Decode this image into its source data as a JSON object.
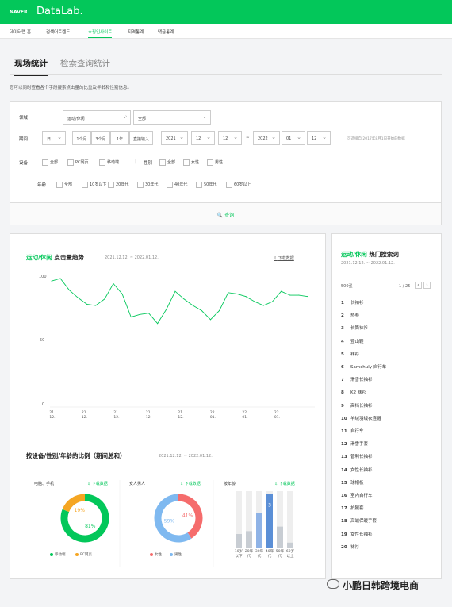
{
  "header": {
    "logo": "NAVER",
    "brand": "DataLab."
  },
  "nav": [
    "데이터랩 홈",
    "검색어트렌드",
    "쇼핑인사이트",
    "지역통계",
    "댓글통계"
  ],
  "tabs": [
    "现场统计",
    "检索查询统计"
  ],
  "desc": "您可以同时查看各个字段搜索点击量的比重及年龄和性别信息。",
  "filter": {
    "field_label": "领域",
    "cat1": "运动/休闲",
    "cat2": "全部",
    "period_label": "期间",
    "period_unit": "日",
    "periods": [
      "1个月",
      "3个月",
      "1年",
      "直接输入"
    ],
    "start": [
      "2021",
      "12",
      "12"
    ],
    "tilde": "~",
    "end": [
      "2022",
      "01",
      "12"
    ],
    "hint": "可选择自 2017年8月1日开始的数据",
    "device_label": "设备",
    "devices": [
      "全部",
      "PC网页",
      "移动端"
    ],
    "gender_label": "性别",
    "genders": [
      "全部",
      "女性",
      "男性"
    ],
    "age_label": "年龄",
    "ages": [
      "全部",
      "10岁以下",
      "20年代",
      "30年代",
      "40年代",
      "50年代",
      "60岁以上"
    ],
    "search": "查询"
  },
  "trend": {
    "cat": "运动/休闲",
    "title": "点击量趋势",
    "date": "2021.12.12. ~ 2022.01.12.",
    "download": "下载数据",
    "ylabels": [
      "100",
      "50",
      "0"
    ],
    "xlabels": [
      [
        "21.",
        "12."
      ],
      [
        "21.",
        "12."
      ],
      [
        "21.",
        "12."
      ],
      [
        "21.",
        "12."
      ],
      [
        "21.",
        "12."
      ],
      [
        "22.",
        "01."
      ],
      [
        "22.",
        "01."
      ],
      [
        "22.",
        "01."
      ]
    ]
  },
  "chart_data": {
    "type": "line",
    "ylim": [
      0,
      100
    ],
    "values": [
      98,
      100,
      91,
      85,
      80,
      79,
      84,
      96,
      88,
      70,
      72,
      73,
      65,
      76,
      90,
      84,
      79,
      75,
      68,
      75,
      89,
      88,
      86,
      82,
      79,
      82,
      90,
      87,
      87,
      86
    ]
  },
  "ratio": {
    "title": "按设备/性别/年龄的比例（期间总和）",
    "date": "2021.12.12. ~ 2022.01.12.",
    "device_title": "电脑、手机",
    "gender_title": "女人男人",
    "age_title": "按年龄",
    "download": "下载数据",
    "device_values": [
      81,
      19
    ],
    "device_pct": [
      "81%",
      "19%"
    ],
    "device_legend": [
      "移动端",
      "PC网页"
    ],
    "gender_values": [
      41,
      59
    ],
    "gender_pct": [
      "41%",
      "59%"
    ],
    "gender_legend": [
      "女性",
      "男性"
    ],
    "age_bars": [
      25,
      30,
      62,
      95,
      38,
      10
    ],
    "age_labels": [
      [
        "10岁",
        "以下"
      ],
      [
        "20年",
        "代"
      ],
      [
        "30年",
        "代"
      ],
      [
        "40年",
        "代"
      ],
      [
        "50年",
        "代"
      ],
      [
        "60岁",
        "以上"
      ]
    ],
    "age_marker": "3",
    "colors": {
      "green": "#03c75a",
      "orange": "#f5a623",
      "red": "#f56c6c",
      "blue": "#7fb9f0"
    }
  },
  "ranking": {
    "cat": "运动/休闲",
    "title": "热门搜索词",
    "date": "2021.12.12. ~ 2022.01.12.",
    "top": "500强",
    "page": "1 / 25",
    "items": [
      "长袖衫",
      "热卷",
      "长筒袜衫",
      "登山鞋",
      "袜衫",
      "Samchuly 自行车",
      "滑雪长袖衫",
      "K2 袜衫",
      "高档长袖衫",
      "羊绒羽绒衣连帽",
      "自行车",
      "滑雪手套",
      "普利长袖衫",
      "女性长袖衫",
      "球帽板",
      "室内自行车",
      "护腿套",
      "高端保暖手套",
      "女性长袖衫",
      "袜衫"
    ]
  },
  "watermark": "小鹏日韩跨境电商"
}
